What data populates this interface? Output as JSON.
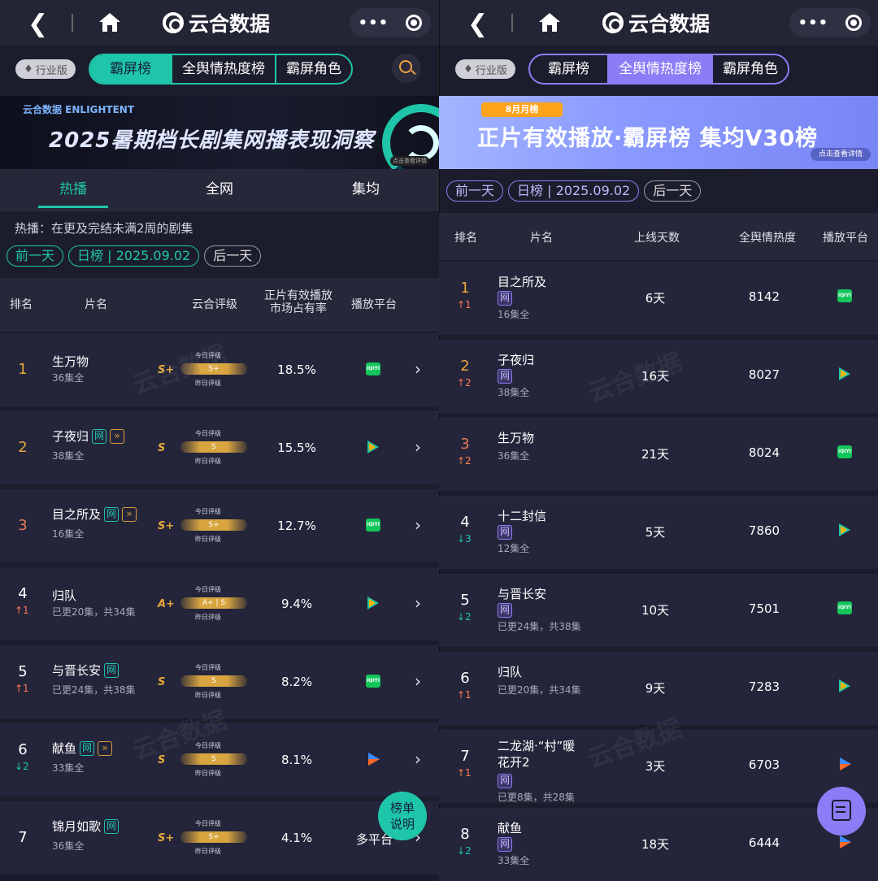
{
  "app": {
    "brand": "云合数据",
    "more": "•••"
  },
  "left": {
    "badge": "行业版",
    "tabs": [
      "霸屏榜",
      "全舆情热度榜",
      "霸屏角色"
    ],
    "banner": {
      "logo": "云合数据 ENLIGHTENT",
      "title": "2025暑期档长剧集网播表现洞察",
      "small": "点击查看详情"
    },
    "subtabs": [
      "热播",
      "全网",
      "集均"
    ],
    "note": "热播：在更及完结未满2周的剧集",
    "date": {
      "prev": "前一天",
      "current": "日榜 | 2025.09.02",
      "next": "后一天"
    },
    "headers": {
      "rank": "排名",
      "name": "片名",
      "grade": "云合评级",
      "share": "正片有效播放\n市场占有率",
      "platform": "播放平台"
    },
    "grade_labels": {
      "today": "今日评级",
      "yesterday": "昨日评级"
    },
    "rows": [
      {
        "rank": "1",
        "change": "",
        "title": "生万物",
        "eps": "36集全",
        "tags": [],
        "grade": "S+",
        "bar": "S+",
        "share": "18.5%",
        "platform": "iqiyi",
        "rank_color": "#e7a83b"
      },
      {
        "rank": "2",
        "change": "",
        "title": "子夜归",
        "eps": "38集全",
        "tags": [
          "网",
          "vip"
        ],
        "grade": "S",
        "bar": "S",
        "share": "15.5%",
        "platform": "tencent",
        "rank_color": "#e7a83b"
      },
      {
        "rank": "3",
        "change": "",
        "title": "目之所及",
        "eps": "16集全",
        "tags": [
          "网",
          "vip"
        ],
        "grade": "S+",
        "bar": "S+",
        "share": "12.7%",
        "platform": "iqiyi",
        "rank_color": "#e8795a"
      },
      {
        "rank": "4",
        "change": "↑1",
        "dir": "up",
        "title": "归队",
        "eps": "已更20集，共34集",
        "tags": [],
        "grade": "A+",
        "bar": "A+ | S",
        "share": "9.4%",
        "platform": "tencent",
        "rank_color": "#fff"
      },
      {
        "rank": "5",
        "change": "↑1",
        "dir": "up",
        "title": "与晋长安",
        "eps": "已更24集，共38集",
        "tags": [
          "网"
        ],
        "grade": "S",
        "bar": "S",
        "share": "8.2%",
        "platform": "iqiyi",
        "rank_color": "#fff"
      },
      {
        "rank": "6",
        "change": "↓2",
        "dir": "down",
        "title": "献鱼",
        "eps": "33集全",
        "tags": [
          "网",
          "vip"
        ],
        "grade": "S",
        "bar": "S",
        "share": "8.1%",
        "platform": "youku",
        "rank_color": "#fff"
      },
      {
        "rank": "7",
        "change": "",
        "title": "锦月如歌",
        "eps": "36集全",
        "tags": [
          "网"
        ],
        "grade": "S+",
        "bar": "S+",
        "share": "4.1%",
        "platform": "多平台",
        "rank_color": "#fff"
      }
    ],
    "fab": "榜单说明"
  },
  "right": {
    "badge": "行业版",
    "tabs": [
      "霸屏榜",
      "全舆情热度榜",
      "霸屏角色"
    ],
    "banner": {
      "month": "8月月榜",
      "title": "正片有效播放·霸屏榜 集均V30榜",
      "cta": "点击查看详情"
    },
    "date": {
      "prev": "前一天",
      "current": "日榜 | 2025.09.02",
      "next": "后一天"
    },
    "headers": {
      "rank": "排名",
      "name": "片名",
      "days": "上线天数",
      "heat": "全舆情热度",
      "platform": "播放平台"
    },
    "rows": [
      {
        "rank": "1",
        "change": "↑1",
        "dir": "up",
        "title": "目之所及",
        "eps": "16集全",
        "days": "6天",
        "heat": "8142",
        "platform": "iqiyi",
        "rank_color": "#e7a83b"
      },
      {
        "rank": "2",
        "change": "↑2",
        "dir": "up",
        "title": "子夜归",
        "eps": "38集全",
        "days": "16天",
        "heat": "8027",
        "platform": "tencent",
        "rank_color": "#e7a83b"
      },
      {
        "rank": "3",
        "change": "↑2",
        "dir": "up",
        "title": "生万物",
        "eps": "36集全",
        "days": "21天",
        "heat": "8024",
        "platform": "iqiyi",
        "rank_color": "#e8795a",
        "notag": true
      },
      {
        "rank": "4",
        "change": "↓3",
        "dir": "down",
        "title": "十二封信",
        "eps": "12集全",
        "days": "5天",
        "heat": "7860",
        "platform": "tencent",
        "rank_color": "#fff"
      },
      {
        "rank": "5",
        "change": "↓2",
        "dir": "down",
        "title": "与晋长安",
        "eps": "已更24集，共38集",
        "days": "10天",
        "heat": "7501",
        "platform": "iqiyi",
        "rank_color": "#fff"
      },
      {
        "rank": "6",
        "change": "↑1",
        "dir": "up",
        "title": "归队",
        "eps": "已更20集，共34集",
        "days": "9天",
        "heat": "7283",
        "platform": "tencent",
        "rank_color": "#fff",
        "notag": true
      },
      {
        "rank": "7",
        "change": "↑1",
        "dir": "up",
        "title": "二龙湖·“村”暖花开2",
        "eps": "已更8集，共28集",
        "days": "3天",
        "heat": "6703",
        "platform": "youku",
        "rank_color": "#fff"
      },
      {
        "rank": "8",
        "change": "↓2",
        "dir": "down",
        "title": "献鱼",
        "eps": "33集全",
        "days": "18天",
        "heat": "6444",
        "platform": "youku",
        "rank_color": "#fff"
      }
    ],
    "tag": "网"
  },
  "colors": {
    "teal": "#1fc5a8",
    "purple": "#8c7cf5",
    "gold": "#e7a83b",
    "up": "#ff7a50",
    "down": "#1fc5a8"
  }
}
